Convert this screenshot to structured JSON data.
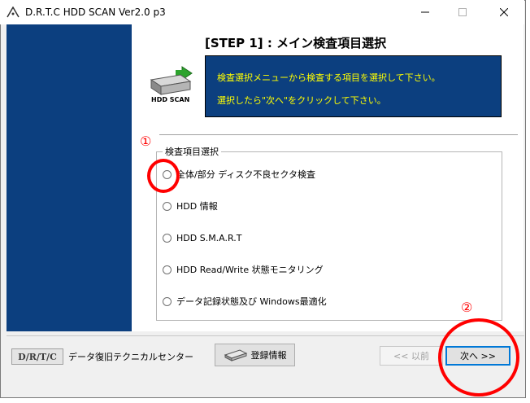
{
  "window": {
    "title": "D.R.T.C HDD SCAN Ver2.0 p3"
  },
  "header": {
    "step_title": "[STEP 1] : メイン検査項目選択",
    "logo_text": "HDD SCAN"
  },
  "info": {
    "line1": "検査選択メニューから検査する項目を選択して下さい。",
    "line2": "選択したら\"次へ\"をクリックして下さい。"
  },
  "group": {
    "legend": "検査項目選択",
    "options": [
      {
        "label": "全体/部分  ディスク不良セクタ検査"
      },
      {
        "label": "HDD 情報"
      },
      {
        "label": "HDD S.M.A.R.T"
      },
      {
        "label": "HDD Read/Write 状態モニタリング"
      },
      {
        "label": "データ記録状態及び Windows最適化"
      }
    ]
  },
  "footer": {
    "logo": "D/R/T/C",
    "company": "データ復旧テクニカルセンター",
    "register_label": "登録情報",
    "prev_label": "<< 以前",
    "next_label": "次へ >>"
  },
  "annotations": {
    "one": "①",
    "two": "②"
  },
  "colors": {
    "panel_blue": "#0c3f7f",
    "info_text": "#ffff00",
    "annotation_red": "#ff0000"
  }
}
